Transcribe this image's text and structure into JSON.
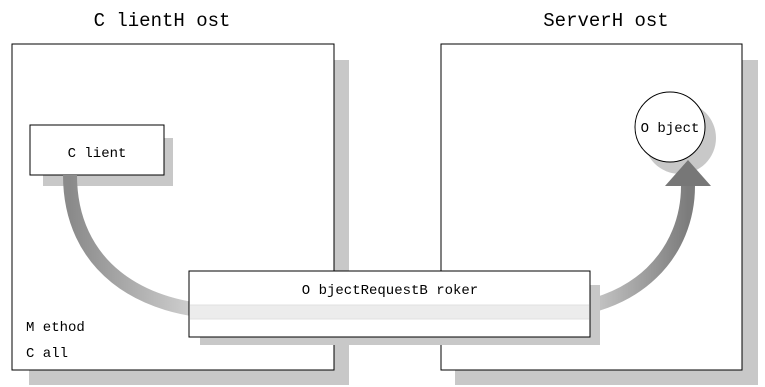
{
  "client_host": {
    "title": "C lientH ost",
    "client_box_label": "C lient"
  },
  "server_host": {
    "title": "ServerH ost",
    "object_label": "O bject"
  },
  "orb": {
    "label": "O bjectRequestB roker"
  },
  "method_call": {
    "line1": "M ethod",
    "line2": "C all"
  },
  "colors": {
    "shadow": "#c8c8c8",
    "border": "#000000",
    "arrow_dark": "#7a7a7a",
    "arrow_light": "#f2f2f2"
  }
}
